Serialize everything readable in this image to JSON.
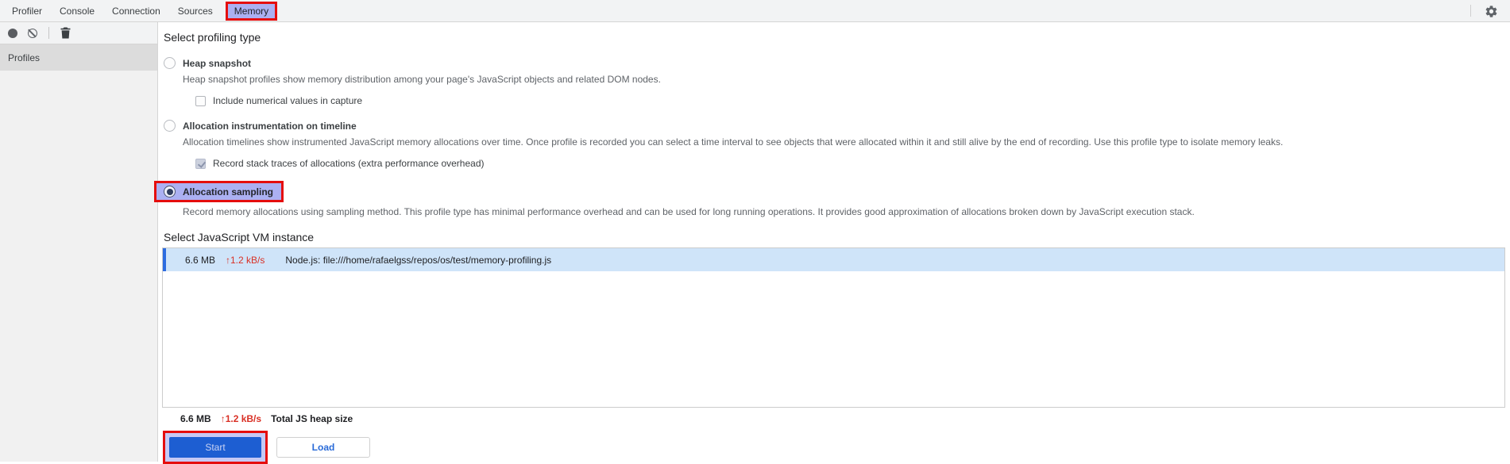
{
  "tabs": {
    "items": [
      {
        "label": "Profiler",
        "active": false
      },
      {
        "label": "Console",
        "active": false
      },
      {
        "label": "Connection",
        "active": false
      },
      {
        "label": "Sources",
        "active": false
      },
      {
        "label": "Memory",
        "active": true,
        "annotated": true
      }
    ]
  },
  "toolbar": {
    "icons": [
      "record-icon",
      "clear-icon",
      "trash-icon"
    ],
    "settings_icon": "gear-icon"
  },
  "sidebar": {
    "items": [
      {
        "label": "Profiles",
        "selected": true
      }
    ]
  },
  "profiling": {
    "heading": "Select profiling type",
    "options": [
      {
        "label": "Heap snapshot",
        "selected": false,
        "description": "Heap snapshot profiles show memory distribution among your page's JavaScript objects and related DOM nodes.",
        "checkbox": {
          "label": "Include numerical values in capture",
          "checked": false
        }
      },
      {
        "label": "Allocation instrumentation on timeline",
        "selected": false,
        "description": "Allocation timelines show instrumented JavaScript memory allocations over time. Once profile is recorded you can select a time interval to see objects that were allocated within it and still alive by the end of recording. Use this profile type to isolate memory leaks.",
        "checkbox": {
          "label": "Record stack traces of allocations (extra performance overhead)",
          "checked": true
        }
      },
      {
        "label": "Allocation sampling",
        "selected": true,
        "annotated": true,
        "description": "Record memory allocations using sampling method. This profile type has minimal performance overhead and can be used for long running operations. It provides good approximation of allocations broken down by JavaScript execution stack."
      }
    ]
  },
  "vm": {
    "heading": "Select JavaScript VM instance",
    "rows": [
      {
        "size": "6.6 MB",
        "rate": "↑1.2 kB/s",
        "name": "Node.js: file:///home/rafaelgss/repos/os/test/memory-profiling.js",
        "selected": true
      }
    ],
    "footer": {
      "size": "6.6 MB",
      "rate": "↑1.2 kB/s",
      "label": "Total JS heap size"
    }
  },
  "actions": {
    "start": "Start",
    "load": "Load"
  },
  "colors": {
    "annotation_red": "#e50d0d",
    "highlight_lavender": "#abb0f2",
    "selected_row_blue": "#cfe4f9",
    "row_accent_blue": "#2d6ce0",
    "start_button_blue": "#1d5ed2",
    "load_text_blue": "#2a6bd8",
    "rate_red": "#d93025",
    "toolbar_gray": "#f2f3f4"
  }
}
